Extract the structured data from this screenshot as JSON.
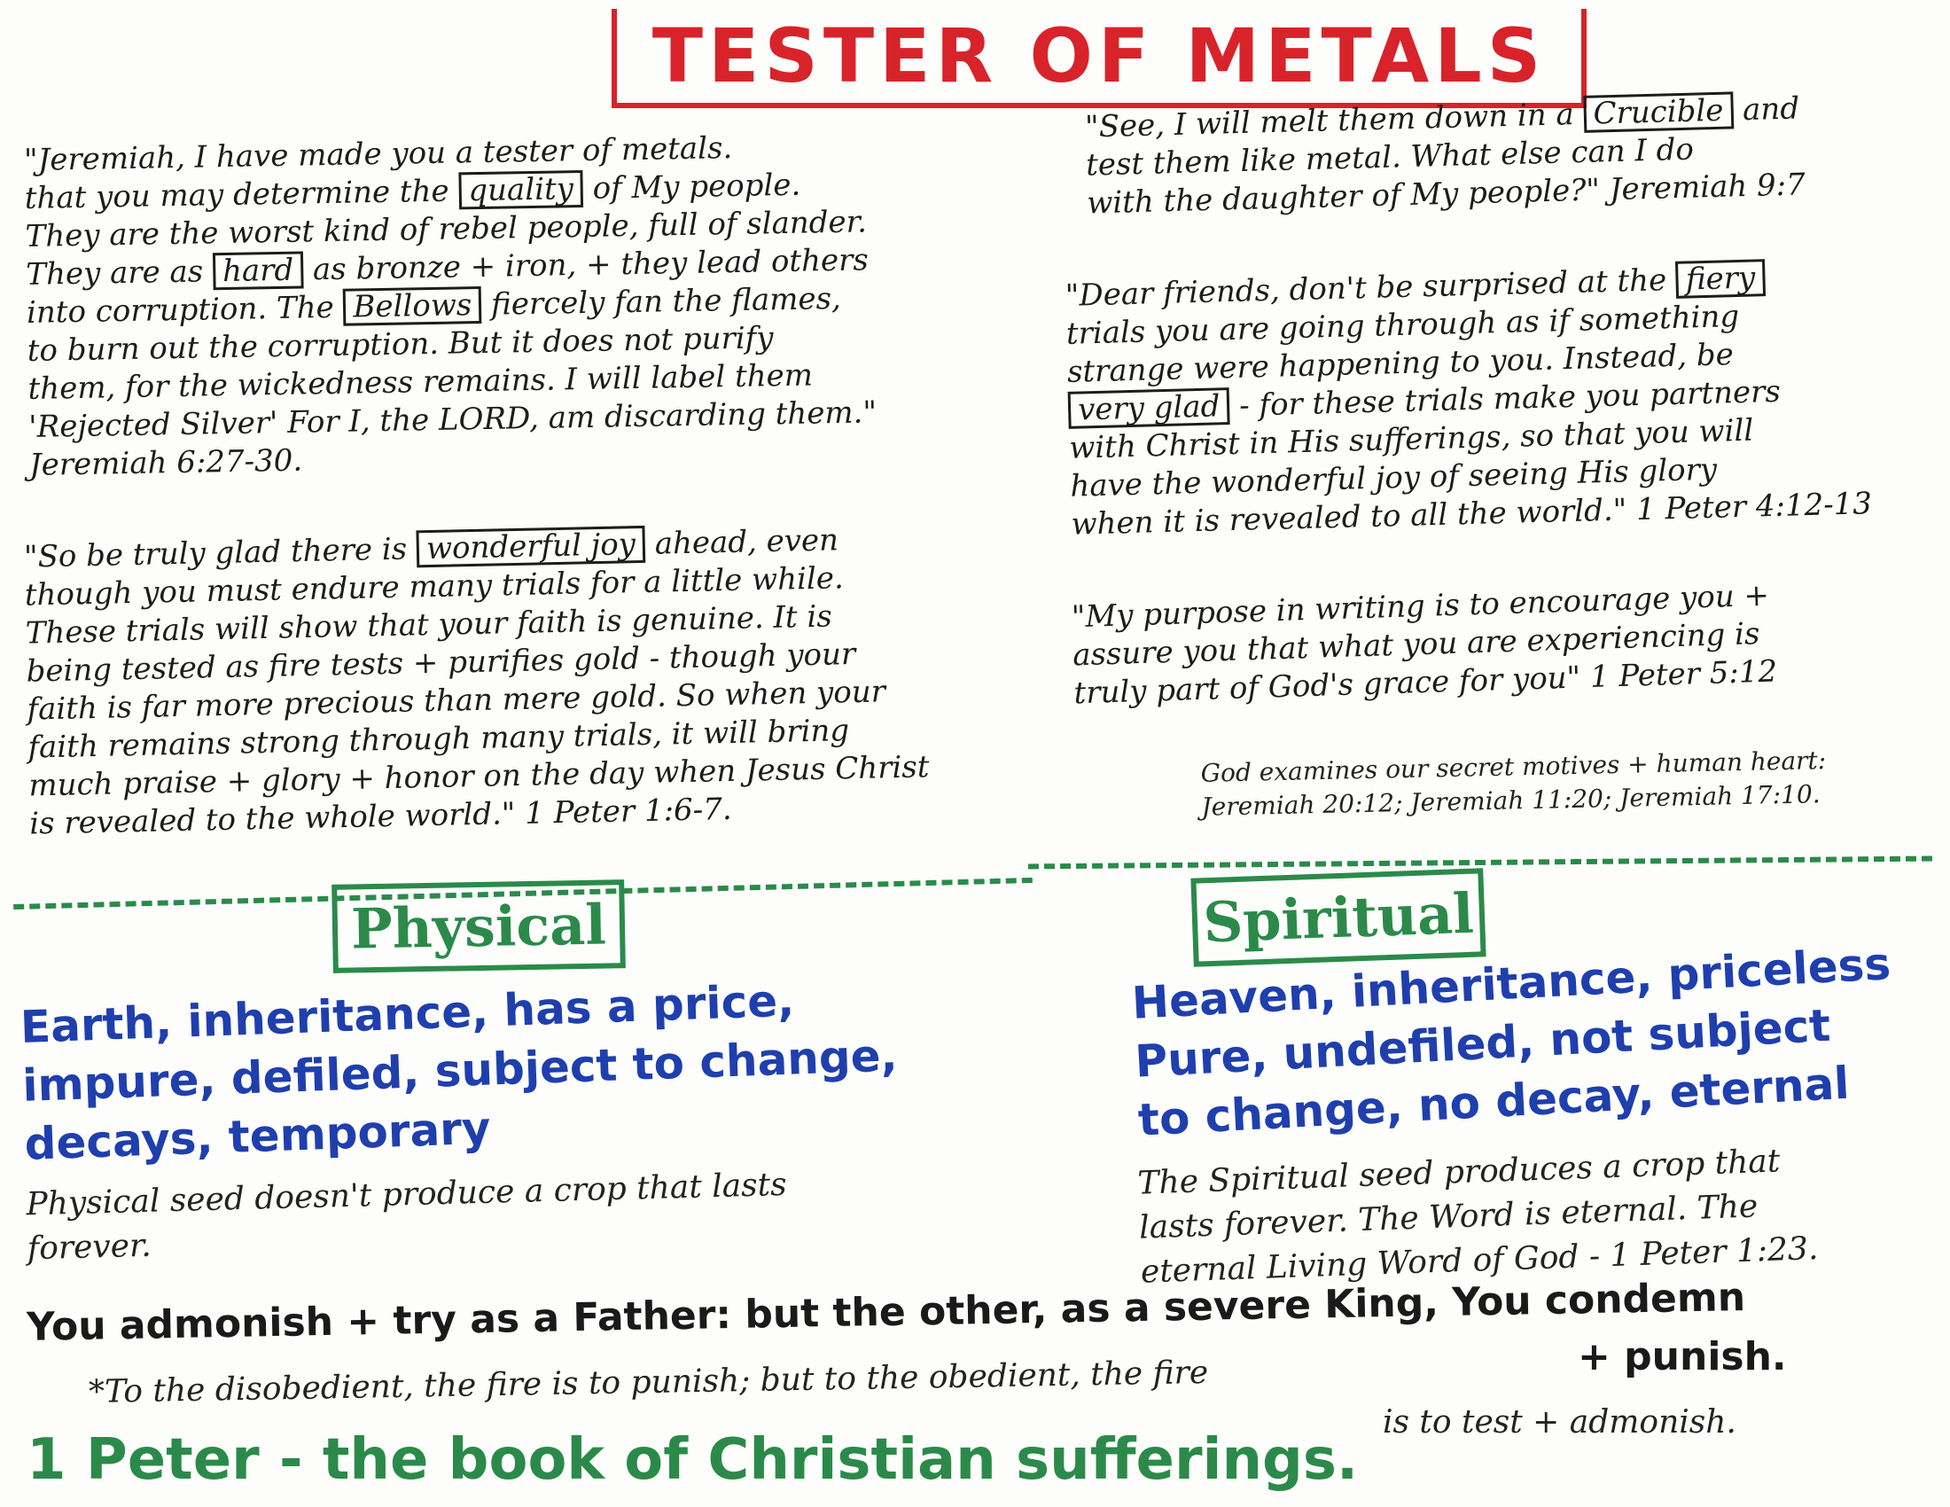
{
  "title": "TESTER OF METALS",
  "left_top": {
    "l1a": "\"Jeremiah, I have made you a tester of metals.",
    "l2a": "that you may determine the ",
    "l2_box": "quality",
    "l2b": " of My people.",
    "l3": "They are the worst kind of rebel people, full of slander.",
    "l4a": "They are as ",
    "l4_box": "hard",
    "l4b": " as bronze + iron, + they lead others",
    "l5a": "into corruption. The ",
    "l5_box": "Bellows",
    "l5b": " fiercely fan the flames,",
    "l6": "to burn out the corruption. But it does not purify",
    "l7": "them, for the wickedness remains. I will label them",
    "l8": "'Rejected Silver' For I, the LORD, am discarding them.\"",
    "l9": "Jeremiah 6:27-30."
  },
  "left_mid": {
    "l1a": "\"So be truly glad there is ",
    "l1_box": "wonderful joy",
    "l1b": " ahead, even",
    "l2": "though you must endure many trials for a little while.",
    "l3": "These trials will show that your faith is genuine. It is",
    "l4": "being tested as fire tests + purifies gold - though your",
    "l5": "faith is far more precious than mere gold. So when your",
    "l6": "faith remains strong through many trials, it will bring",
    "l7": "much praise + glory + honor on the day when Jesus Christ",
    "l8": "is revealed to the whole world.\" 1 Peter 1:6-7."
  },
  "right_top": {
    "l1a": "\"See, I will melt them down in a ",
    "l1_box": "Crucible",
    "l1b": " and",
    "l2": "test them like metal. What else can I do",
    "l3": "with the daughter of My people?\" Jeremiah 9:7"
  },
  "right_mid": {
    "l1a": "\"Dear friends, don't be surprised at the ",
    "l1_box": "fiery",
    "l2": "trials you are going through as if something",
    "l3": "strange were happening to you. Instead, be",
    "l4_box": "very glad",
    "l4b": " - for these trials make you partners",
    "l5": "with Christ in His sufferings, so that you will",
    "l6": "have the wonderful joy of seeing His glory",
    "l7": "when it is revealed to all the world.\" 1 Peter 4:12-13"
  },
  "right_purpose": {
    "l1": "\"My purpose in writing is to encourage you +",
    "l2": "assure you that what you are experiencing is",
    "l3": "truly part of God's grace for you\" 1 Peter 5:12"
  },
  "god_examines": {
    "l1": "God examines our secret motives + human heart:",
    "l2": "Jeremiah 20:12; Jeremiah 11:20; Jeremiah 17:10."
  },
  "physical": {
    "label": "Physical",
    "l1": "Earth, inheritance, has a price,",
    "l2": "impure, defiled, subject to change,",
    "l3": "decays, temporary",
    "n1": "Physical seed doesn't produce a crop that lasts",
    "n2": "forever."
  },
  "spiritual": {
    "label": "Spiritual",
    "l1": "Heaven, inheritance, priceless",
    "l2": "Pure, undefiled, not subject",
    "l3": "to change, no decay, eternal",
    "n1": "The Spiritual seed produces a crop that",
    "n2": "lasts forever. The Word is eternal. The",
    "n3": "eternal Living Word of God - 1 Peter 1:23."
  },
  "admonish": {
    "line1": "You admonish + try as a Father: but the other, as a severe King, You condemn",
    "line2": "+ punish.",
    "note1": "*To the disobedient, the fire is to punish; but to the obedient, the fire",
    "note2": "is to test + admonish."
  },
  "footer": "1 Peter - the book of Christian sufferings.",
  "colors": {
    "red": "#d8232a",
    "green": "#2b8a4a",
    "blue": "#1f3fae"
  }
}
